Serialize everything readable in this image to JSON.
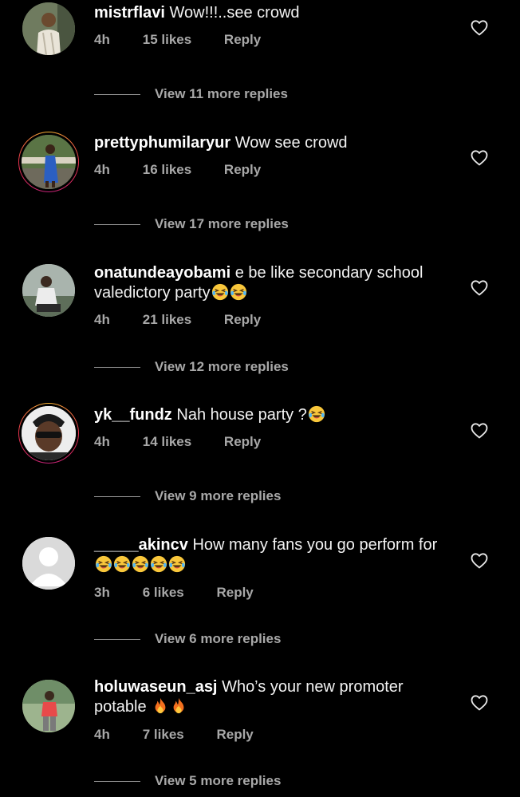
{
  "colors": {
    "background": "#000000",
    "text": "#f2f2f2",
    "meta": "#a8a8a8",
    "story_ring": "#e8334c"
  },
  "icons": {
    "like": "heart-outline-icon",
    "laugh": "face-with-tears-of-joy-emoji",
    "fire": "fire-emoji",
    "default_avatar": "default-user-avatar-icon"
  },
  "comments": [
    {
      "username": "mistrflavi",
      "text": "Wow!!!..see crowd",
      "time": "4h",
      "likes": "15 likes",
      "reply": "Reply",
      "view_replies": "View 11 more replies",
      "story_ring": false
    },
    {
      "username": "prettyphumilaryur",
      "text": "Wow see crowd",
      "time": "4h",
      "likes": "16 likes",
      "reply": "Reply",
      "view_replies": "View 17 more replies",
      "story_ring": true
    },
    {
      "username": "onatundeayobami",
      "text": "e be like secondary school valedictory party",
      "time": "4h",
      "likes": "21 likes",
      "reply": "Reply",
      "view_replies": "View 12 more replies",
      "story_ring": false
    },
    {
      "username": "yk__fundz",
      "text": "Nah house party ?",
      "time": "4h",
      "likes": "14 likes",
      "reply": "Reply",
      "view_replies": "View 9 more replies",
      "story_ring": true
    },
    {
      "username": "_____akincv",
      "text": "How many fans you go perform for",
      "time": "3h",
      "likes": "6 likes",
      "reply": "Reply",
      "view_replies": "View 6 more replies",
      "story_ring": false
    },
    {
      "username": "holuwaseun_asj",
      "text": "Who’s your new promoter potable",
      "time": "4h",
      "likes": "7 likes",
      "reply": "Reply",
      "view_replies": "View 5 more replies",
      "story_ring": false
    }
  ]
}
